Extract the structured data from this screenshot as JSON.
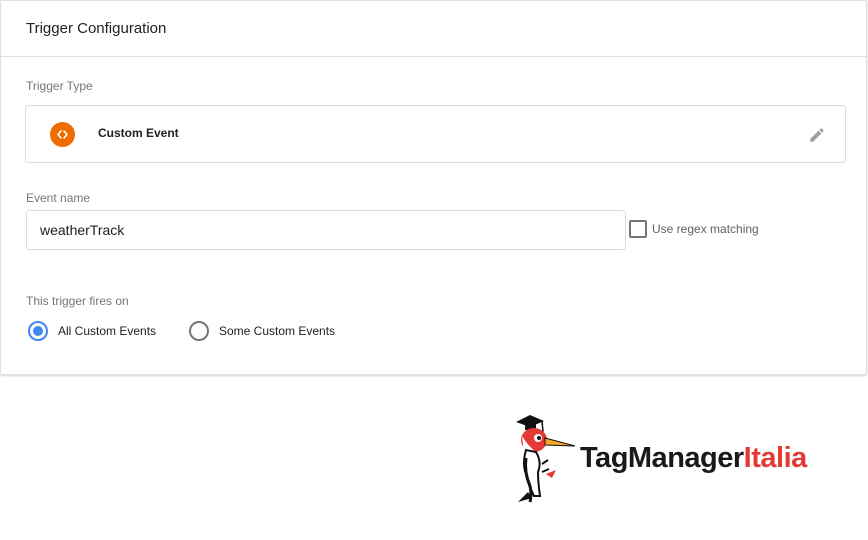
{
  "card": {
    "title": "Trigger Configuration"
  },
  "trigger_type": {
    "label": "Trigger Type",
    "name": "Custom Event",
    "icon": "custom-event-code-icon",
    "icon_color": "#ef6c00"
  },
  "event_name": {
    "label": "Event name",
    "value": "weatherTrack",
    "regex_label": "Use regex matching",
    "regex_checked": false
  },
  "fires_on": {
    "label": "This trigger fires on",
    "options": [
      {
        "label": "All Custom Events",
        "selected": true
      },
      {
        "label": "Some Custom Events",
        "selected": false
      }
    ]
  },
  "logo": {
    "text_dark": "TagManager",
    "text_accent": "Italia",
    "dark_color": "#1a1a1a",
    "accent_color": "#e53935"
  },
  "colors": {
    "accent_blue": "#4285f4",
    "border": "#dadce0"
  }
}
